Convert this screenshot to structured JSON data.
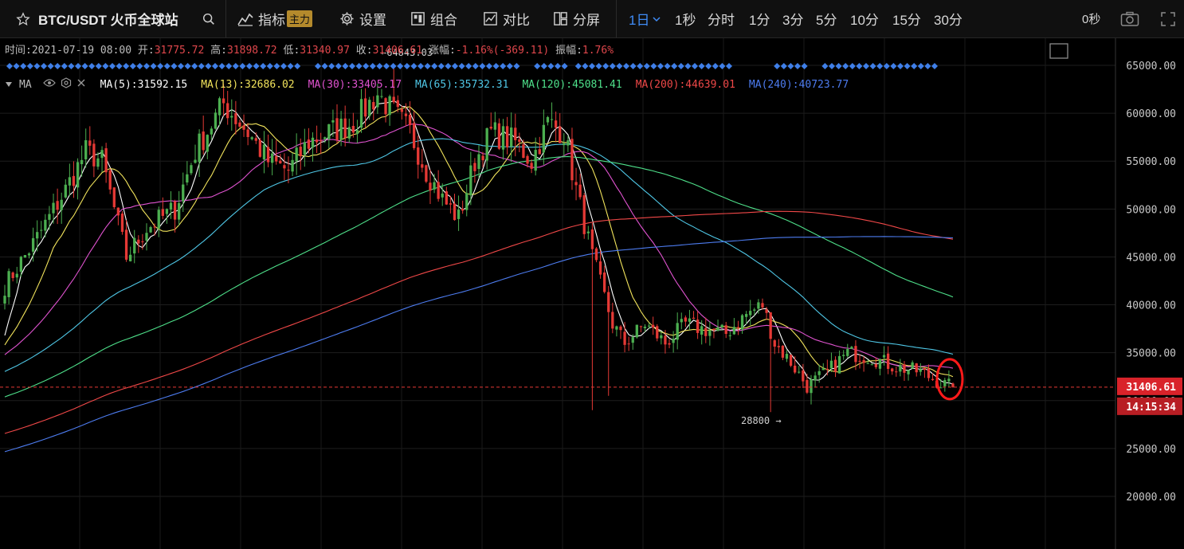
{
  "toolbar": {
    "symbol": "BTC/USDT 火币全球站",
    "indicators_label": "指标",
    "indicators_badge": "主力",
    "settings_label": "设置",
    "combine_label": "组合",
    "compare_label": "对比",
    "split_label": "分屏",
    "intervals": [
      "1日",
      "1秒",
      "分时",
      "1分",
      "3分",
      "5分",
      "10分",
      "15分",
      "30分"
    ],
    "active_interval": "1日",
    "countdown": "0秒"
  },
  "ohlc": {
    "time_label": "时间:",
    "time": "2021-07-19 08:00",
    "open_label": "开:",
    "open": "31775.72",
    "high_label": "高:",
    "high": "31898.72",
    "low_label": "低:",
    "low": "31340.97",
    "close_label": "收:",
    "close": "31406.61",
    "change_label": "涨幅:",
    "change": "-1.16%(-369.11)",
    "amplitude_label": "振幅:",
    "amplitude": "1.76%"
  },
  "ma_legend": {
    "title": "MA",
    "items": [
      {
        "label": "MA(5):31592.15",
        "color": "#ffffff"
      },
      {
        "label": "MA(13):32686.02",
        "color": "#f2e45c"
      },
      {
        "label": "MA(30):33405.17",
        "color": "#e053d0"
      },
      {
        "label": "MA(65):35732.31",
        "color": "#4fc7e6"
      },
      {
        "label": "MA(120):45081.41",
        "color": "#4ee08a"
      },
      {
        "label": "MA(200):44639.01",
        "color": "#f04848"
      },
      {
        "label": "MA(240):40723.77",
        "color": "#4d7cf0"
      }
    ]
  },
  "colors": {
    "up": "#4caf50",
    "down": "#e53935",
    "price_line": "#e53935",
    "highlight": "#ff1a1a"
  },
  "chart_data": {
    "type": "candlestick",
    "y_ticks": [
      20000,
      25000,
      30000,
      35000,
      40000,
      45000,
      50000,
      55000,
      60000,
      65000
    ],
    "y_tick_labels": [
      "20000.00",
      "25000.00",
      "30000.00",
      "35000.00",
      "40000.00",
      "45000.00",
      "50000.00",
      "55000.00",
      "60000.00",
      "65000.00"
    ],
    "ylim": [
      17000,
      67000
    ],
    "current_price": 31406.61,
    "current_price_label": "31406.61",
    "countdown_label": "14:15:34",
    "max_label": "←64843.03",
    "max_value": 64843.03,
    "min_label": "28800 →",
    "min_value": 28800,
    "candles_count": 200,
    "close_anchors": [
      [
        0,
        42000
      ],
      [
        8,
        47000
      ],
      [
        15,
        52000
      ],
      [
        20,
        56000
      ],
      [
        24,
        55000
      ],
      [
        30,
        45000
      ],
      [
        35,
        48000
      ],
      [
        42,
        50000
      ],
      [
        47,
        56000
      ],
      [
        54,
        61000
      ],
      [
        60,
        58000
      ],
      [
        65,
        55000
      ],
      [
        70,
        54000
      ],
      [
        75,
        57000
      ],
      [
        80,
        58000
      ],
      [
        86,
        59000
      ],
      [
        92,
        62000
      ],
      [
        96,
        60000
      ],
      [
        100,
        58000
      ],
      [
        104,
        54000
      ],
      [
        108,
        51000
      ],
      [
        112,
        49000
      ],
      [
        116,
        55000
      ],
      [
        120,
        58000
      ],
      [
        126,
        57000
      ],
      [
        130,
        55000
      ],
      [
        134,
        59000
      ],
      [
        138,
        58000
      ],
      [
        141,
        52000
      ],
      [
        145,
        45000
      ],
      [
        150,
        38000
      ],
      [
        153,
        36000
      ],
      [
        158,
        38000
      ],
      [
        163,
        36000
      ],
      [
        168,
        38000
      ],
      [
        172,
        37500
      ],
      [
        178,
        37000
      ],
      [
        183,
        39000
      ],
      [
        187,
        40000
      ],
      [
        190,
        36000
      ],
      [
        194,
        34000
      ],
      [
        198,
        31500
      ],
      [
        203,
        33000
      ],
      [
        208,
        35000
      ],
      [
        214,
        34500
      ],
      [
        220,
        33500
      ],
      [
        226,
        33000
      ],
      [
        231,
        31800
      ],
      [
        234,
        31406
      ]
    ],
    "high_extremes": [
      [
        96,
        64843
      ]
    ],
    "low_extremes": [
      [
        145,
        29000
      ],
      [
        149,
        30500
      ],
      [
        189,
        28800
      ],
      [
        199,
        29600
      ]
    ],
    "ma_series": [
      {
        "name": "MA(5)",
        "color": "#ffffff",
        "period": 5
      },
      {
        "name": "MA(13)",
        "color": "#f2e45c",
        "period": 13
      },
      {
        "name": "MA(30)",
        "color": "#e053d0",
        "period": 30
      },
      {
        "name": "MA(65)",
        "color": "#4fc7e6",
        "period": 65
      },
      {
        "name": "MA(120)",
        "color": "#4ee08a",
        "period": 120
      },
      {
        "name": "MA(200)",
        "color": "#f04848",
        "period": 200
      },
      {
        "name": "MA(240)",
        "color": "#4d7cf0",
        "period": 240
      }
    ],
    "grid": true
  }
}
